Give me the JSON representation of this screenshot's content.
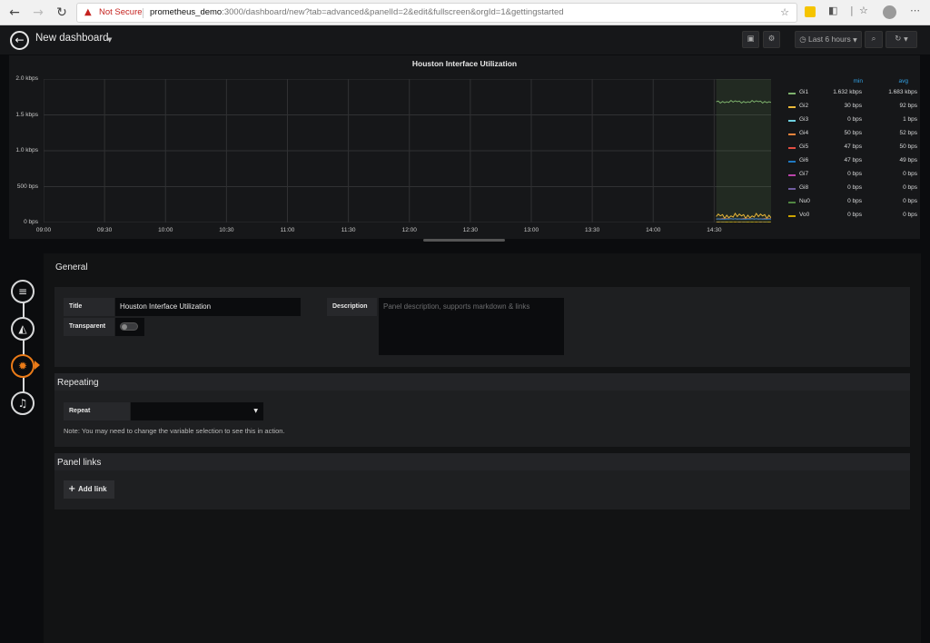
{
  "browser": {
    "not_secure": "Not Secure",
    "url_host": "prometheus_demo",
    "url_rest": ":3000/dashboard/new?tab=advanced&panelId=2&edit&fullscreen&orgId=1&gettingstarted"
  },
  "topbar": {
    "title": "New dashboard",
    "time_range": "Last 6 hours"
  },
  "chart_data": {
    "type": "line",
    "title": "Houston Interface Utilization",
    "y_ticks": [
      "2.0 kbps",
      "1.5 kbps",
      "1.0 kbps",
      "500 bps",
      "0 bps"
    ],
    "x_ticks": [
      "09:00",
      "09:30",
      "10:00",
      "10:30",
      "11:00",
      "11:30",
      "12:00",
      "12:30",
      "13:00",
      "13:30",
      "14:00",
      "14:30"
    ],
    "ylim_bps": [
      0,
      2000
    ],
    "xlim_time": [
      "09:00",
      "14:58"
    ],
    "data_start_time": "14:31",
    "legend_columns": [
      "min",
      "avg"
    ],
    "legend_placement": "right",
    "series": [
      {
        "name": "Gi1",
        "color": "#7eb26d",
        "min": "1.632 kbps",
        "avg": "1.683 kbps",
        "avg_bps": 1683
      },
      {
        "name": "Gi2",
        "color": "#eab839",
        "min": "30 bps",
        "avg": "92 bps",
        "avg_bps": 92
      },
      {
        "name": "Gi3",
        "color": "#6ed0e0",
        "min": "0 bps",
        "avg": "1 bps",
        "avg_bps": 1
      },
      {
        "name": "Gi4",
        "color": "#ef843c",
        "min": "50 bps",
        "avg": "52 bps",
        "avg_bps": 52
      },
      {
        "name": "Gi5",
        "color": "#e24d42",
        "min": "47 bps",
        "avg": "50 bps",
        "avg_bps": 50
      },
      {
        "name": "Gi6",
        "color": "#1f78c1",
        "min": "47 bps",
        "avg": "49 bps",
        "avg_bps": 49
      },
      {
        "name": "Gi7",
        "color": "#ba43a9",
        "min": "0 bps",
        "avg": "0 bps",
        "avg_bps": 0
      },
      {
        "name": "Gi8",
        "color": "#705da0",
        "min": "0 bps",
        "avg": "0 bps",
        "avg_bps": 0
      },
      {
        "name": "Nu0",
        "color": "#508642",
        "min": "0 bps",
        "avg": "0 bps",
        "avg_bps": 0
      },
      {
        "name": "Vo0",
        "color": "#cca300",
        "min": "0 bps",
        "avg": "0 bps",
        "avg_bps": 0
      }
    ]
  },
  "general": {
    "heading": "General",
    "title_label": "Title",
    "title_value": "Houston Interface Utilization",
    "transparent_label": "Transparent",
    "description_label": "Description",
    "description_placeholder": "Panel description, supports markdown & links"
  },
  "repeating": {
    "heading": "Repeating",
    "repeat_label": "Repeat",
    "note": "Note: You may need to change the variable selection to see this in action."
  },
  "panel_links": {
    "heading": "Panel links",
    "add_link": "Add link"
  }
}
